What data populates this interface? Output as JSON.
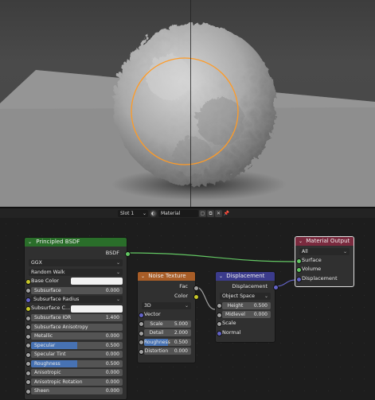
{
  "header": {
    "slot": "Slot 1",
    "material_name": "Material"
  },
  "principled": {
    "title": "Principled BSDF",
    "output": "BSDF",
    "distribution": "GGX",
    "subsurface_method": "Random Walk",
    "base_color_label": "Base Color",
    "rows": [
      {
        "label": "Subsurface",
        "value": "0.000",
        "fill": 0
      },
      {
        "label": "Subsurface Radius",
        "value": "",
        "fill": 0
      },
      {
        "label": "Subsurface C...",
        "value": "",
        "fill": 0
      },
      {
        "label": "Subsurface IOR",
        "value": "1.400",
        "fill": 0
      },
      {
        "label": "Subsurface Anisotropy",
        "value": "",
        "fill": 0
      },
      {
        "label": "Metallic",
        "value": "0.000",
        "fill": 0
      },
      {
        "label": "Specular",
        "value": "0.500",
        "fill": 0.5
      },
      {
        "label": "Specular Tint",
        "value": "0.000",
        "fill": 0
      },
      {
        "label": "Roughness",
        "value": "0.500",
        "fill": 0.5
      },
      {
        "label": "Anisotropic",
        "value": "0.000",
        "fill": 0
      },
      {
        "label": "Anisotropic Rotation",
        "value": "0.000",
        "fill": 0
      },
      {
        "label": "Sheen",
        "value": "0.000",
        "fill": 0
      }
    ]
  },
  "noise": {
    "title": "Noise Texture",
    "out_fac": "Fac",
    "out_color": "Color",
    "dimensions": "3D",
    "vector_label": "Vector",
    "fields": [
      {
        "label": "Scale",
        "value": "5.000"
      },
      {
        "label": "Detail",
        "value": "2.000"
      },
      {
        "label": "Roughness",
        "value": "0.500",
        "fill": 0.5
      },
      {
        "label": "Distortion",
        "value": "0.000"
      }
    ]
  },
  "displacement": {
    "title": "Displacement",
    "output": "Displacement",
    "space": "Object Space",
    "fields": [
      {
        "label": "Height",
        "value": "0.500"
      },
      {
        "label": "Midlevel",
        "value": "0.000"
      }
    ],
    "scale_label": "Scale",
    "normal_label": "Normal"
  },
  "material_output": {
    "title": "Material Output",
    "target": "All",
    "inputs": [
      "Surface",
      "Volume",
      "Displacement"
    ]
  },
  "colors": {
    "shader_header": "#2a6e2a",
    "texture_header": "#a85d27",
    "vector_header": "#3b3b8c",
    "output_header": "#7a2a3e",
    "shader_socket": "#63c763",
    "float_socket": "#a1a1a1",
    "color_socket": "#c7c729",
    "vector_socket": "#6363c7",
    "selection": "#ff9b26"
  }
}
